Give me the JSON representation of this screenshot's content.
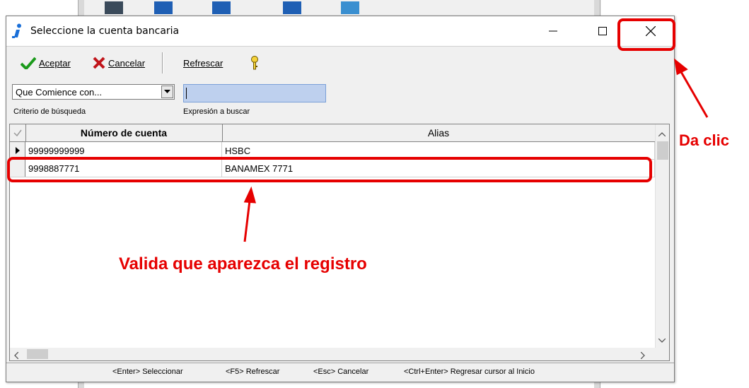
{
  "dialog": {
    "title": "Seleccione la cuenta bancaria",
    "title_icon": "info-icon"
  },
  "toolbar": {
    "accept_label": "Aceptar",
    "cancel_label": "Cancelar",
    "refresh_label": "Refrescar",
    "help_icon": "key-help-icon"
  },
  "search": {
    "criteria_value": "Que Comience con...",
    "criteria_caption": "Criterio de búsqueda",
    "expression_caption": "Expresión a buscar",
    "expression_value": ""
  },
  "grid": {
    "columns": [
      "Número de cuenta",
      "Alias"
    ],
    "rows": [
      {
        "account": "99999999999",
        "alias": "HSBC"
      },
      {
        "account": "9998887771",
        "alias": "BANAMEX 7771"
      }
    ]
  },
  "statusbar": {
    "hints": [
      "<Enter> Seleccionar",
      "<F5> Refrescar",
      "<Esc> Cancelar",
      "<Ctrl+Enter> Regresar cursor al Inicio"
    ]
  },
  "annotations": {
    "close_note": "Da clic",
    "row_note": "Valida que aparezca el registro",
    "color": "#e60000"
  }
}
